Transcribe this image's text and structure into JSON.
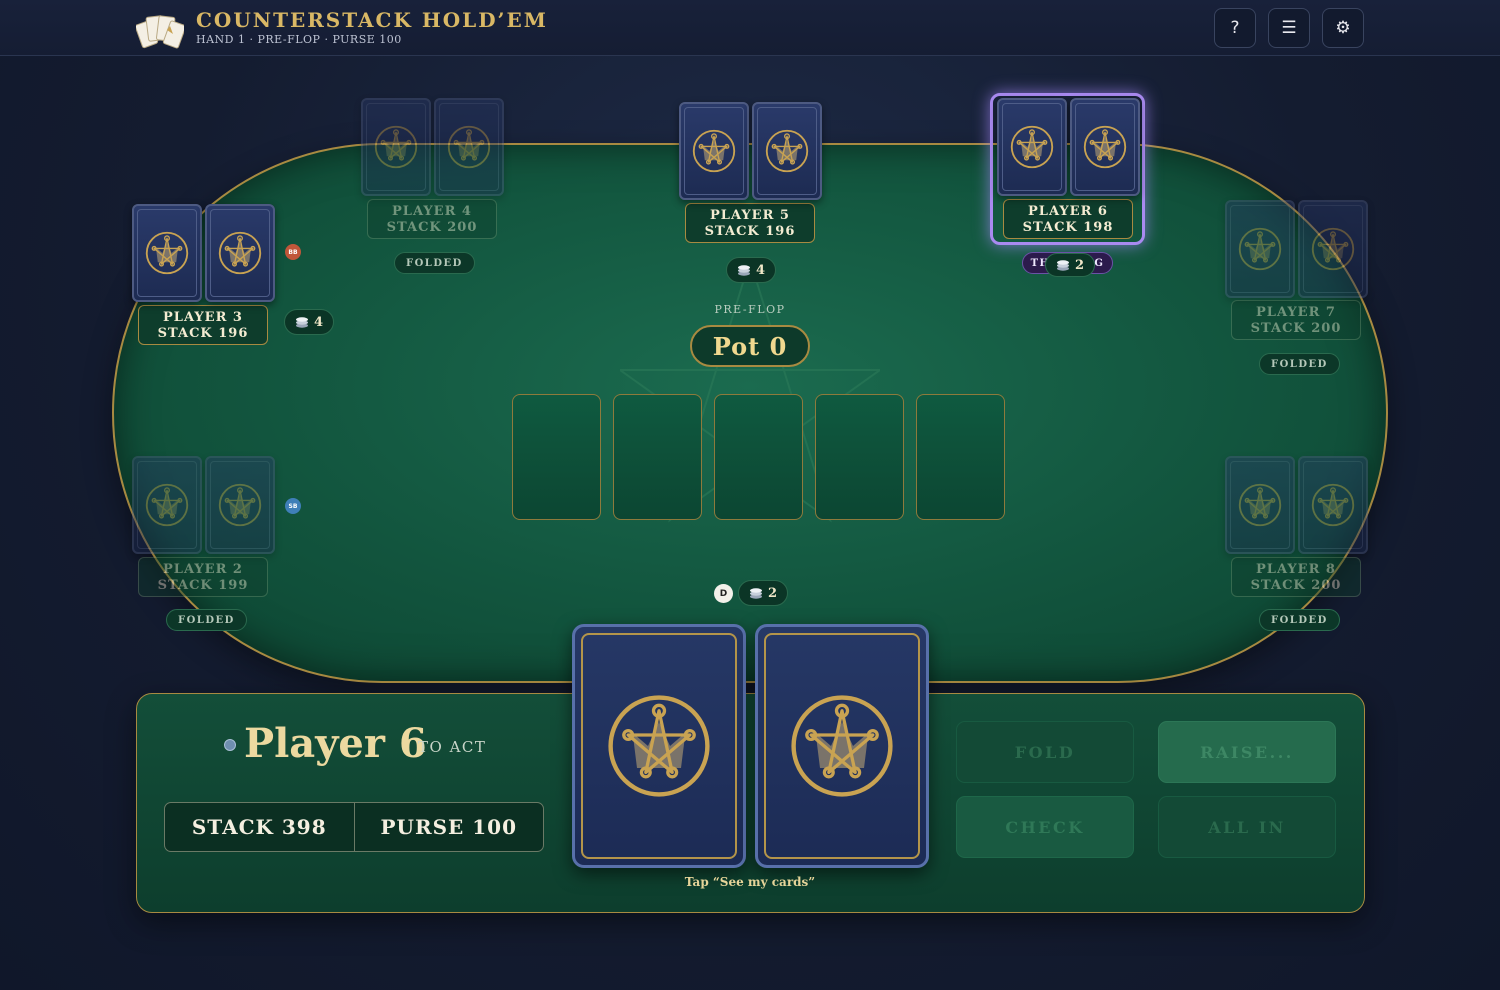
{
  "header": {
    "title": "COUNTERSTACK HOLD’EM",
    "subtitle": "HAND 1 · PRE-FLOP · PURSE 100",
    "help_label": "?",
    "menu_label": "☰",
    "settings_label": "⚙"
  },
  "table": {
    "phase": "PRE-FLOP",
    "pot": "Pot 0"
  },
  "players": {
    "p2": {
      "name": "PLAYER 2",
      "stack": "STACK 199",
      "status": "FOLDED",
      "blind": "SB"
    },
    "p3": {
      "name": "PLAYER 3",
      "stack": "STACK 196",
      "bet": "4",
      "blind": "BB"
    },
    "p4": {
      "name": "PLAYER 4",
      "stack": "STACK 200",
      "status": "FOLDED"
    },
    "p5": {
      "name": "PLAYER 5",
      "stack": "STACK 196",
      "bet": "4"
    },
    "p6": {
      "name": "PLAYER 6",
      "stack": "STACK 198",
      "status": "THINKING",
      "bet": "2"
    },
    "p7": {
      "name": "PLAYER 7",
      "stack": "STACK 200",
      "status": "FOLDED"
    },
    "p8": {
      "name": "PLAYER 8",
      "stack": "STACK 200",
      "status": "FOLDED"
    }
  },
  "hero": {
    "dealer": "D",
    "bet": "2"
  },
  "panel": {
    "turn_name": "Player 6",
    "turn_sub": "TO ACT",
    "stack": "STACK 398",
    "purse": "PURSE 100",
    "hint": "Tap “See my cards”",
    "fold_label": "FOLD",
    "raise_label": "RAISE...",
    "check_label": "CHECK",
    "allin_label": "ALL IN"
  },
  "colors": {
    "felt": "#12553e",
    "gold": "#a88a41",
    "card_back": "#1d2b52",
    "active_glow": "#a98af0",
    "big_blind": "#c0563a",
    "small_blind": "#3f7fb8"
  }
}
